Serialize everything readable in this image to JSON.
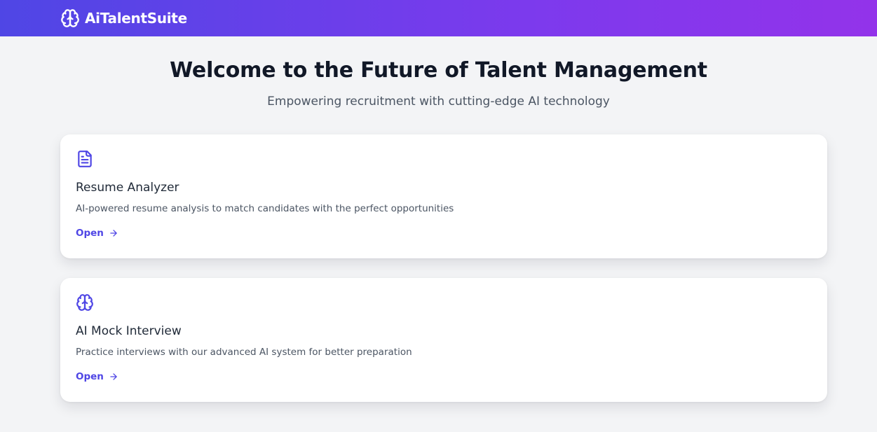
{
  "header": {
    "brand_name": "AiTalentSuite",
    "brand_icon": "brain-icon",
    "gradient_start": "#4f46e5",
    "gradient_end": "#9333ea"
  },
  "hero": {
    "title": "Welcome to the Future of Talent Management",
    "subtitle": "Empowering recruitment with cutting-edge AI technology"
  },
  "cards": [
    {
      "icon": "document-icon",
      "title": "Resume Analyzer",
      "description": "AI-powered resume analysis to match candidates with the perfect opportunities",
      "link_label": "Open",
      "link_icon": "arrow-right-icon"
    },
    {
      "icon": "brain-icon",
      "title": "AI Mock Interview",
      "description": "Practice interviews with our advanced AI system for better preparation",
      "link_label": "Open",
      "link_icon": "arrow-right-icon"
    }
  ],
  "colors": {
    "accent": "#4f46e5",
    "background": "#f3f4f6",
    "card": "#ffffff"
  }
}
